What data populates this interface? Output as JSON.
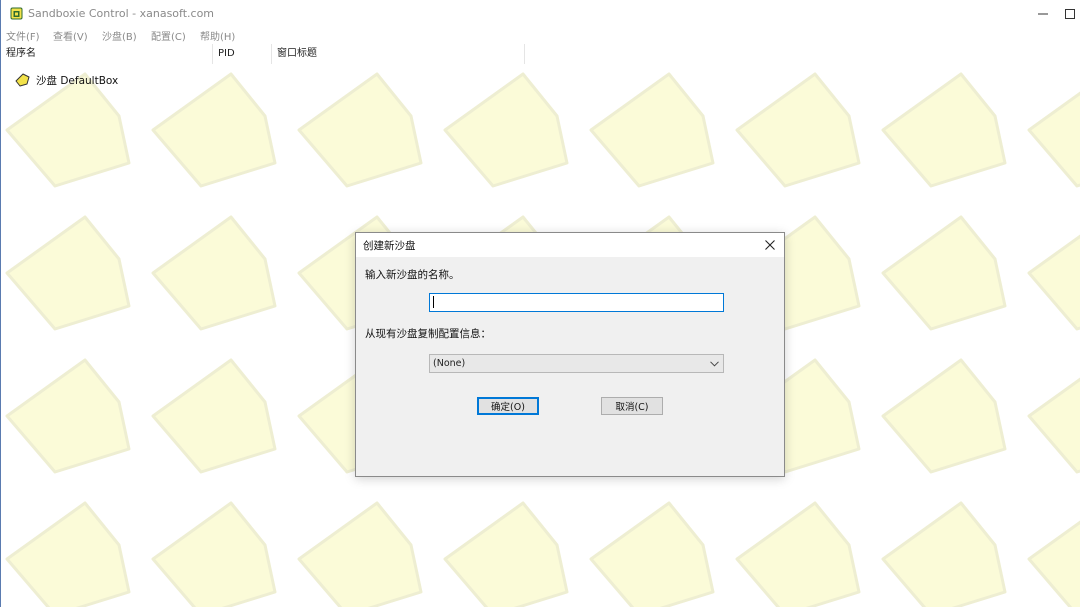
{
  "window": {
    "title": "Sandboxie Control - xanasoft.com"
  },
  "menu": [
    {
      "label": "文件(F)"
    },
    {
      "label": "查看(V)"
    },
    {
      "label": "沙盘(B)"
    },
    {
      "label": "配置(C)"
    },
    {
      "label": "帮助(H)"
    }
  ],
  "columns": [
    {
      "label": "程序名"
    },
    {
      "label": "PID"
    },
    {
      "label": "窗口标题"
    }
  ],
  "tree": {
    "items": [
      {
        "label": "沙盘 DefaultBox",
        "icon": "sandbox-icon"
      }
    ]
  },
  "dialog": {
    "title": "创建新沙盘",
    "name_prompt": "输入新沙盘的名称。",
    "name_value": "",
    "copy_prompt": "从现有沙盘复制配置信息：",
    "copy_selected": "(None)",
    "ok_label": "确定(O)",
    "cancel_label": "取消(C)"
  },
  "colors": {
    "watermark_fill": "#fbfbd8",
    "watermark_stroke": "#eeeed2",
    "accent": "#0078d7",
    "sandbox_icon": "#f2e24a"
  }
}
